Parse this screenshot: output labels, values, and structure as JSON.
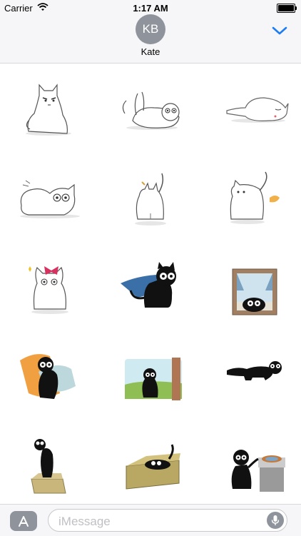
{
  "status_bar": {
    "carrier": "Carrier",
    "time": "1:17 AM",
    "wifi_icon": "wifi-icon",
    "battery_icon": "battery-icon"
  },
  "header": {
    "avatar_initials": "KB",
    "contact_name": "Kate",
    "chevron_icon": "chevron-down-icon",
    "accent_color": "#1e7cf2"
  },
  "stickers": [
    {
      "name": "sticker-white-cat-grumpy-sitting"
    },
    {
      "name": "sticker-white-cat-rolling-back"
    },
    {
      "name": "sticker-white-cat-sleeping"
    },
    {
      "name": "sticker-white-cat-lying-wide-eyed"
    },
    {
      "name": "sticker-white-cat-back-view"
    },
    {
      "name": "sticker-white-cat-farting"
    },
    {
      "name": "sticker-white-cat-with-bow"
    },
    {
      "name": "sticker-black-cat-with-cape"
    },
    {
      "name": "sticker-black-cat-at-window"
    },
    {
      "name": "sticker-black-cat-on-pillows"
    },
    {
      "name": "sticker-black-cat-in-doorway"
    },
    {
      "name": "sticker-black-cat-stretching"
    },
    {
      "name": "sticker-black-cat-in-small-box"
    },
    {
      "name": "sticker-black-cat-in-box"
    },
    {
      "name": "sticker-black-cat-with-record-player"
    }
  ],
  "input_bar": {
    "placeholder": "iMessage",
    "appstore_icon": "app-store-icon",
    "mic_icon": "microphone-icon"
  }
}
